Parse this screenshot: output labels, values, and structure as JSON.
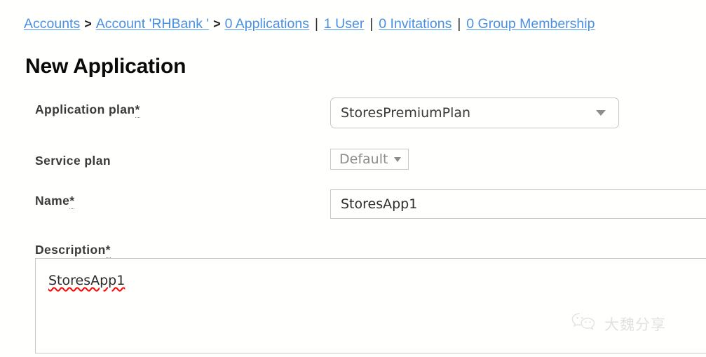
{
  "breadcrumb": {
    "items": [
      {
        "label": "Accounts",
        "sep_after": ">"
      },
      {
        "label": "Account 'RHBank '",
        "sep_after": ">"
      },
      {
        "label": "0 Applications",
        "sep_after": "|"
      },
      {
        "label": "1 User",
        "sep_after": "|"
      },
      {
        "label": "0 Invitations",
        "sep_after": "|"
      },
      {
        "label": "0 Group Membership",
        "sep_after": ""
      }
    ],
    "sep_arrow": ">",
    "sep_pipe": "|",
    "link_color": "#4a90e2"
  },
  "page": {
    "title": "New Application",
    "background": "#fffffd"
  },
  "form": {
    "application_plan": {
      "label": "Application plan",
      "required_mark": "*",
      "value": "StoresPremiumPlan",
      "caret": "chevron-down-icon"
    },
    "service_plan": {
      "label": "Service plan",
      "required_mark": "",
      "value": "Default",
      "caret": "▼",
      "disabled": true
    },
    "name": {
      "label": "Name",
      "required_mark": "*",
      "value": "StoresApp1",
      "placeholder": ""
    },
    "description": {
      "label": "Description",
      "required_mark": "*",
      "value": "StoresApp1",
      "placeholder": "",
      "spellcheck_flagged": true
    }
  },
  "watermark": {
    "text": "大魏分享",
    "icon": "wechat-icon",
    "color": "#b9b9b9"
  }
}
